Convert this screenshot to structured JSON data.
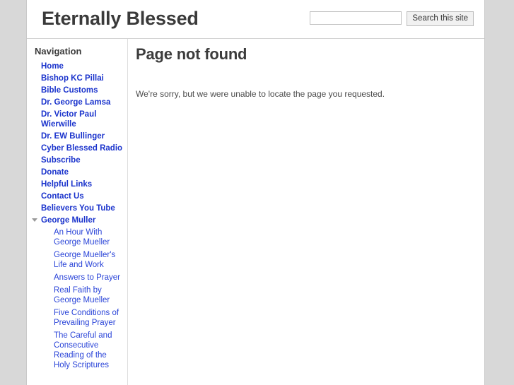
{
  "header": {
    "site_title": "Eternally Blessed",
    "search": {
      "value": "",
      "placeholder": "",
      "button_label": "Search this site"
    }
  },
  "sidebar": {
    "heading": "Navigation",
    "items": [
      {
        "label": "Home"
      },
      {
        "label": "Bishop KC Pillai"
      },
      {
        "label": "Bible Customs"
      },
      {
        "label": "Dr. George Lamsa"
      },
      {
        "label": "Dr. Victor Paul Wierwille"
      },
      {
        "label": "Dr. EW Bullinger"
      },
      {
        "label": "Cyber Blessed Radio"
      },
      {
        "label": "Subscribe"
      },
      {
        "label": "Donate"
      },
      {
        "label": "Helpful Links"
      },
      {
        "label": "Contact Us"
      },
      {
        "label": "Believers You Tube"
      },
      {
        "label": "George Muller",
        "expanded": true,
        "toggle_icon": "chevron-down-icon",
        "children": [
          {
            "label": "An Hour With George Mueller"
          },
          {
            "label": "George Mueller's Life and Work"
          },
          {
            "label": "Answers to Prayer"
          },
          {
            "label": "Real Faith by George Mueller"
          },
          {
            "label": "Five Conditions of Prevailing Prayer"
          },
          {
            "label": "The Careful and Consecutive Reading of the Holy Scriptures"
          }
        ]
      }
    ]
  },
  "main": {
    "title": "Page not found",
    "message": "We're sorry, but we were unable to locate the page you requested."
  },
  "colors": {
    "page_background": "#d8d8d8",
    "content_background": "#ffffff",
    "link": "#1a33cc",
    "sublink": "#2a44d8",
    "heading_text": "#3b3b3b",
    "body_text": "#4a4a4a",
    "border": "#dedede"
  }
}
